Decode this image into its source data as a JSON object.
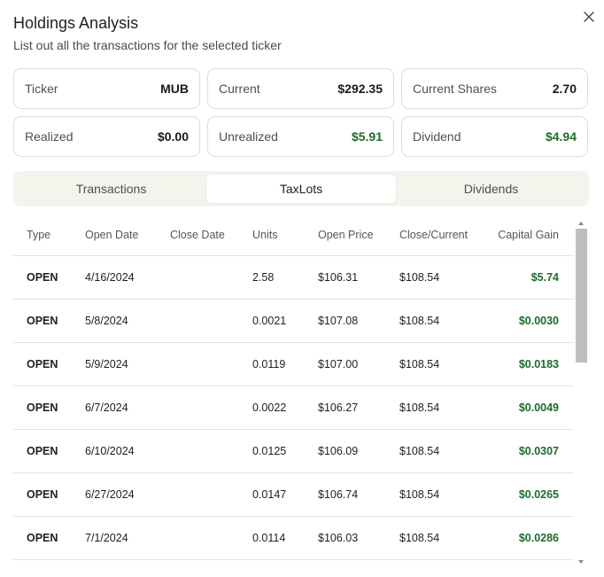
{
  "dialog": {
    "title": "Holdings Analysis",
    "subtitle": "List out all the transactions for the selected ticker"
  },
  "icons": {
    "close": "close-icon"
  },
  "colors": {
    "gain_green": "#1d6b2e",
    "tab_bar_bg": "#f4f3ec",
    "border": "#dcdcdc"
  },
  "summary": {
    "ticker": {
      "label": "Ticker",
      "value": "MUB"
    },
    "current": {
      "label": "Current",
      "value": "$292.35"
    },
    "current_shares": {
      "label": "Current Shares",
      "value": "2.70"
    },
    "realized": {
      "label": "Realized",
      "value": "$0.00"
    },
    "unrealized": {
      "label": "Unrealized",
      "value": "$5.91"
    },
    "dividend": {
      "label": "Dividend",
      "value": "$4.94"
    }
  },
  "tabs": [
    {
      "label": "Transactions",
      "active": false
    },
    {
      "label": "TaxLots",
      "active": true
    },
    {
      "label": "Dividends",
      "active": false
    }
  ],
  "table": {
    "columns": [
      "Type",
      "Open Date",
      "Close Date",
      "Units",
      "Open Price",
      "Close/Current",
      "Capital Gain"
    ],
    "rows": [
      {
        "type": "OPEN",
        "open_date": "4/16/2024",
        "close_date": "",
        "units": "2.58",
        "open_price": "$106.31",
        "close_current": "$108.54",
        "capital_gain": "$5.74"
      },
      {
        "type": "OPEN",
        "open_date": "5/8/2024",
        "close_date": "",
        "units": "0.0021",
        "open_price": "$107.08",
        "close_current": "$108.54",
        "capital_gain": "$0.0030"
      },
      {
        "type": "OPEN",
        "open_date": "5/9/2024",
        "close_date": "",
        "units": "0.0119",
        "open_price": "$107.00",
        "close_current": "$108.54",
        "capital_gain": "$0.0183"
      },
      {
        "type": "OPEN",
        "open_date": "6/7/2024",
        "close_date": "",
        "units": "0.0022",
        "open_price": "$106.27",
        "close_current": "$108.54",
        "capital_gain": "$0.0049"
      },
      {
        "type": "OPEN",
        "open_date": "6/10/2024",
        "close_date": "",
        "units": "0.0125",
        "open_price": "$106.09",
        "close_current": "$108.54",
        "capital_gain": "$0.0307"
      },
      {
        "type": "OPEN",
        "open_date": "6/27/2024",
        "close_date": "",
        "units": "0.0147",
        "open_price": "$106.74",
        "close_current": "$108.54",
        "capital_gain": "$0.0265"
      },
      {
        "type": "OPEN",
        "open_date": "7/1/2024",
        "close_date": "",
        "units": "0.0114",
        "open_price": "$106.03",
        "close_current": "$108.54",
        "capital_gain": "$0.0286"
      }
    ]
  }
}
